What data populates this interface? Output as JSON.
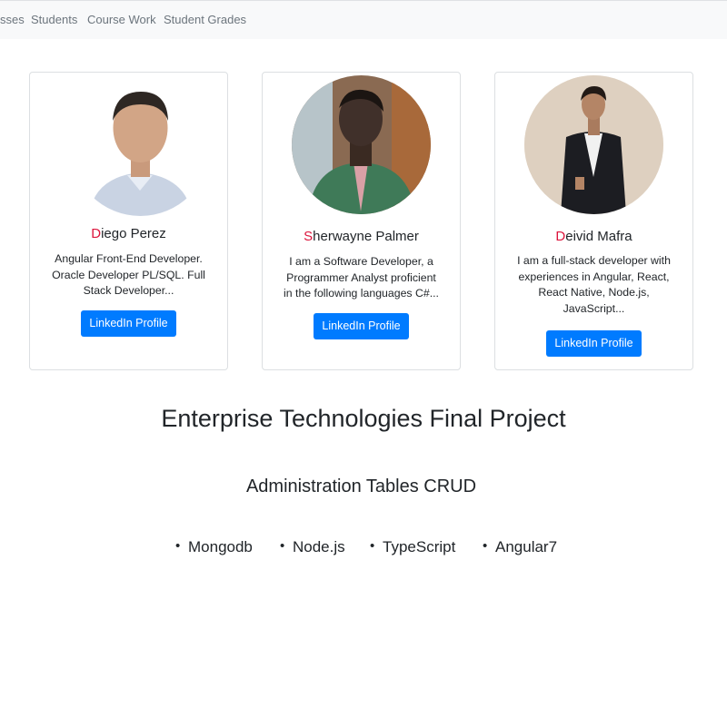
{
  "navbar": {
    "items": [
      {
        "label": "sses"
      },
      {
        "label": "Students"
      },
      {
        "label": "Course Work"
      },
      {
        "label": "Student Grades"
      }
    ]
  },
  "team": [
    {
      "initial": "D",
      "name_rest": "iego Perez",
      "description": "Angular Front-End Developer. Oracle Developer PL/SQL. Full Stack Developer...",
      "button_label": "LinkedIn Profile"
    },
    {
      "initial": "S",
      "name_rest": "herwayne Palmer",
      "description": "I am a Software Developer, a Programmer Analyst proficient in the following languages C#...",
      "button_label": "LinkedIn Profile"
    },
    {
      "initial": "D",
      "name_rest": "eivid Mafra",
      "description": "I am a full-stack developer with experiences in Angular, React, React Native, Node.js, JavaScript...",
      "button_label": "LinkedIn Profile"
    }
  ],
  "main": {
    "title": "Enterprise Technologies Final Project",
    "subtitle": "Administration Tables CRUD",
    "technologies": [
      "Mongodb",
      "Node.js",
      "TypeScript",
      "Angular7"
    ]
  },
  "colors": {
    "accent": "#007bff",
    "initial_letter": "#dc143c",
    "navbar_bg": "#f8f9fa"
  }
}
